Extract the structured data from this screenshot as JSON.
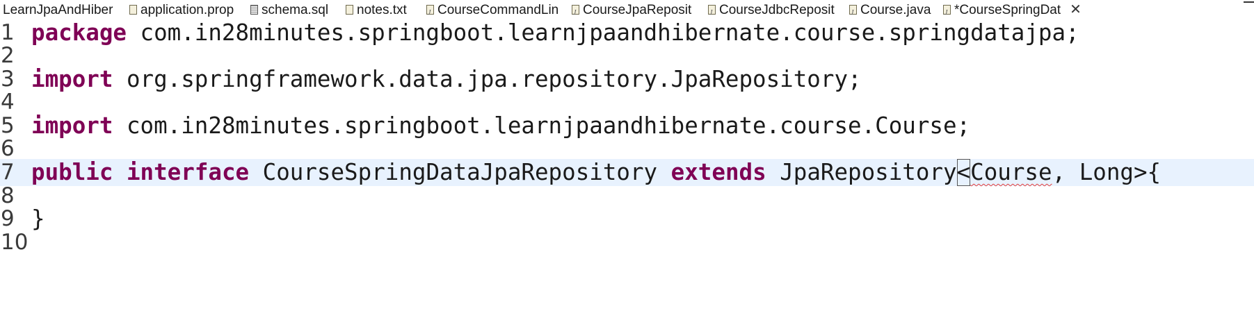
{
  "tabs": [
    {
      "label": "LearnJpaAndHiber",
      "icon": "none",
      "active": false
    },
    {
      "label": "application.prop",
      "icon": "properties-file-icon",
      "active": false
    },
    {
      "label": "schema.sql",
      "icon": "sql-file-icon",
      "active": false
    },
    {
      "label": "notes.txt",
      "icon": "text-file-icon",
      "active": false
    },
    {
      "label": "CourseCommandLin",
      "icon": "java-file-icon",
      "active": false
    },
    {
      "label": "CourseJpaReposit",
      "icon": "java-file-icon",
      "active": false
    },
    {
      "label": "CourseJdbcReposit",
      "icon": "java-file-icon",
      "active": false
    },
    {
      "label": "Course.java",
      "icon": "java-file-icon",
      "active": false
    },
    {
      "label": "*CourseSpringDat",
      "icon": "java-file-icon",
      "active": true
    }
  ],
  "close_glyph": "✕",
  "editor": {
    "line_numbers": [
      "1",
      "2",
      "3",
      "4",
      "5",
      "6",
      "7",
      "8",
      "9",
      "10"
    ],
    "lines": {
      "l1": {
        "kw": "package",
        "rest": " com.in28minutes.springboot.learnjpaandhibernate.course.springdatajpa;"
      },
      "l3": {
        "kw": "import",
        "rest": " org.springframework.data.jpa.repository.JpaRepository;"
      },
      "l5": {
        "kw": "import",
        "rest": " com.in28minutes.springboot.learnjpaandhibernate.course.Course;"
      },
      "l7": {
        "kw1": "public",
        "kw2": "interface",
        "name": " CourseSpringDataJpaRepository ",
        "kw3": "extends",
        "type": " JpaRepository",
        "lt": "<",
        "generic": "Course",
        "tail": ", Long>{"
      },
      "l9": {
        "text": "}"
      }
    },
    "keyword_color": "#7f0055",
    "current_line_color": "#e8f2fe"
  }
}
